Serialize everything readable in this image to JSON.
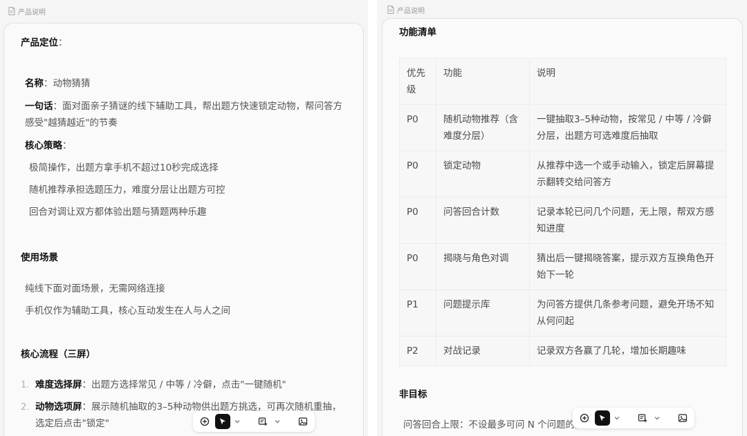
{
  "left": {
    "doc_title": "产品说明",
    "positioning_heading": "产品定位",
    "colon": "：",
    "name_label": "名称",
    "name_value": "动物猜猜",
    "one_liner_label": "一句话",
    "one_liner_line1": "面对面亲子猜谜的线下辅助工具，帮出题方快速锁定动物，帮问答方",
    "one_liner_line2": "感受\"越猜越近\"的节奏",
    "strategy_label": "核心策略",
    "strategies": [
      "极简操作，出题方拿手机不超过10秒完成选择",
      "随机推荐承担选题压力，难度分层让出题方可控",
      "回合对调让双方都体验出题与猜题两种乐趣"
    ],
    "scenario_heading": "使用场景",
    "scenarios": [
      "纯线下面对面场景，无需网络连接",
      "手机仅作为辅助工具，核心互动发生在人与人之间"
    ],
    "flow_heading": "核心流程（三屏）",
    "flow_items": [
      {
        "num": "1.",
        "title": "难度选择屏",
        "text": "出题方选择常见 / 中等 / 冷僻，点击\"一键随机\""
      },
      {
        "num": "2.",
        "title": "动物选项屏",
        "text": "展示随机抽取的3–5种动物供出题方挑选，可再次随机重抽，",
        "text2": "选定后点击\"锁定\""
      }
    ]
  },
  "right": {
    "doc_title": "产品说明",
    "feature_heading": "功能清单",
    "table_headers": [
      "优先级",
      "功能",
      "说明"
    ],
    "table_rows": [
      {
        "priority": "P0",
        "feature": "随机动物推荐（含难度分层）",
        "desc": "一键抽取3–5种动物，按常见 / 中等 / 冷僻分层，出题方可选难度后抽取"
      },
      {
        "priority": "P0",
        "feature": "锁定动物",
        "desc": "从推荐中选一个或手动输入，锁定后屏幕提示翻转交给问答方"
      },
      {
        "priority": "P0",
        "feature": "问答回合计数",
        "desc": "记录本轮已问几个问题，无上限，帮双方感知进度"
      },
      {
        "priority": "P0",
        "feature": "揭晓与角色对调",
        "desc": "猜出后一键揭晓答案，提示双方互换角色开始下一轮"
      },
      {
        "priority": "P1",
        "feature": "问题提示库",
        "desc": "为问答方提供几条参考问题，避免开场不知从何问起"
      },
      {
        "priority": "P2",
        "feature": "对战记录",
        "desc": "记录双方各赢了几轮，增加长期趣味"
      }
    ],
    "non_goal_heading": "非目标",
    "non_goal_first": "问答回合上限：不设最多可问 N 个问题的限制"
  },
  "toolbar": {
    "icons": [
      "add-icon",
      "pointer-icon",
      "caret-down-icon",
      "frame-add-icon",
      "caret-down-icon",
      "image-icon"
    ]
  }
}
